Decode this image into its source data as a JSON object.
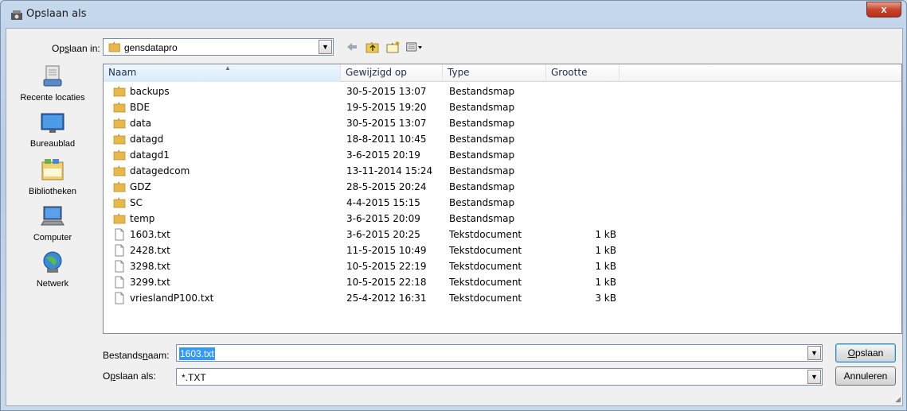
{
  "window": {
    "title": "Opslaan als",
    "close_label": "x"
  },
  "toolbar": {
    "lookin_label": "Opslaan in:",
    "lookin_value": "gensdatapro"
  },
  "places": [
    {
      "label": "Recente locaties",
      "icon": "recent-places-icon"
    },
    {
      "label": "Bureaublad",
      "icon": "desktop-icon"
    },
    {
      "label": "Bibliotheken",
      "icon": "libraries-icon"
    },
    {
      "label": "Computer",
      "icon": "computer-icon"
    },
    {
      "label": "Netwerk",
      "icon": "network-icon"
    }
  ],
  "columns": {
    "name": "Naam",
    "date": "Gewijzigd op",
    "type": "Type",
    "size": "Grootte"
  },
  "files": [
    {
      "name": "backups",
      "date": "30-5-2015 13:07",
      "type": "Bestandsmap",
      "size": "",
      "kind": "folder"
    },
    {
      "name": "BDE",
      "date": "19-5-2015 19:20",
      "type": "Bestandsmap",
      "size": "",
      "kind": "folder"
    },
    {
      "name": "data",
      "date": "30-5-2015 13:07",
      "type": "Bestandsmap",
      "size": "",
      "kind": "folder"
    },
    {
      "name": "datagd",
      "date": "18-8-2011 10:45",
      "type": "Bestandsmap",
      "size": "",
      "kind": "folder"
    },
    {
      "name": "datagd1",
      "date": "3-6-2015 20:19",
      "type": "Bestandsmap",
      "size": "",
      "kind": "folder"
    },
    {
      "name": "datagedcom",
      "date": "13-11-2014 15:24",
      "type": "Bestandsmap",
      "size": "",
      "kind": "folder"
    },
    {
      "name": "GDZ",
      "date": "28-5-2015 20:24",
      "type": "Bestandsmap",
      "size": "",
      "kind": "folder"
    },
    {
      "name": "SC",
      "date": "4-4-2015 15:15",
      "type": "Bestandsmap",
      "size": "",
      "kind": "folder"
    },
    {
      "name": "temp",
      "date": "3-6-2015 20:09",
      "type": "Bestandsmap",
      "size": "",
      "kind": "folder"
    },
    {
      "name": "1603.txt",
      "date": "3-6-2015 20:25",
      "type": "Tekstdocument",
      "size": "1 kB",
      "kind": "file"
    },
    {
      "name": "2428.txt",
      "date": "11-5-2015 10:49",
      "type": "Tekstdocument",
      "size": "1 kB",
      "kind": "file"
    },
    {
      "name": "3298.txt",
      "date": "10-5-2015 22:19",
      "type": "Tekstdocument",
      "size": "1 kB",
      "kind": "file"
    },
    {
      "name": "3299.txt",
      "date": "10-5-2015 22:18",
      "type": "Tekstdocument",
      "size": "1 kB",
      "kind": "file"
    },
    {
      "name": "vrieslandP100.txt",
      "date": "25-4-2012 16:31",
      "type": "Tekstdocument",
      "size": "3 kB",
      "kind": "file"
    }
  ],
  "filename": {
    "label": "Bestandsnaam:",
    "value": "1603.txt"
  },
  "filetype": {
    "label": "Opslaan als:",
    "value": "*.TXT"
  },
  "buttons": {
    "save": "Opslaan",
    "cancel": "Annuleren"
  },
  "colors": {
    "folder": "#e8b84a",
    "selection": "#3399ff",
    "close": "#c8452c"
  }
}
